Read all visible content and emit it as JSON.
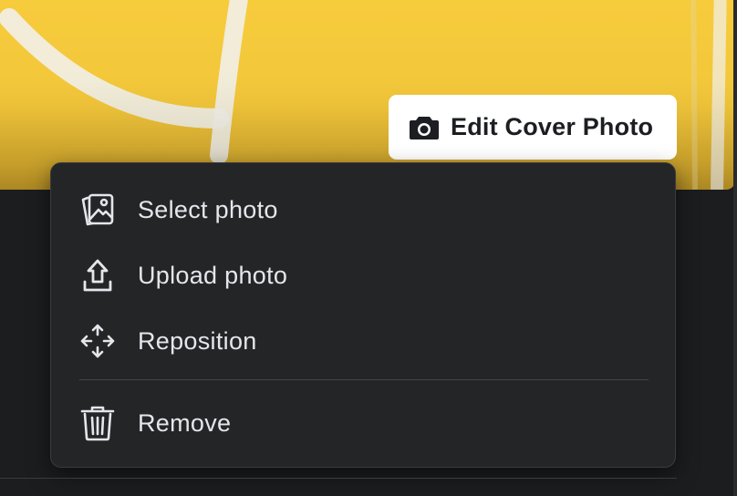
{
  "cover": {
    "edit_button_label": "Edit Cover Photo",
    "edit_button_icon": "camera-icon",
    "background_color": "#f5c83b"
  },
  "menu": {
    "items": [
      {
        "label": "Select photo",
        "icon": "photo-select-icon"
      },
      {
        "label": "Upload photo",
        "icon": "upload-icon"
      },
      {
        "label": "Reposition",
        "icon": "move-arrows-icon"
      },
      {
        "label": "Remove",
        "icon": "trash-icon"
      }
    ],
    "background_color": "#242527",
    "text_color": "#e4e6eb"
  }
}
